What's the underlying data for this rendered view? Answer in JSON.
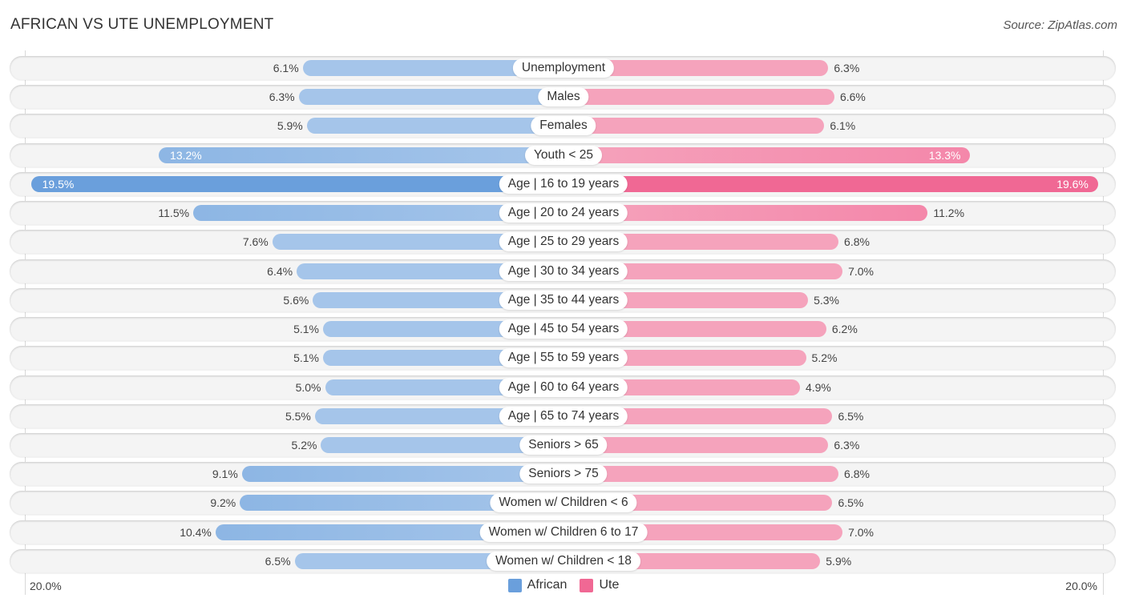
{
  "chart_data": {
    "type": "bar",
    "orientation": "horizontal-diverging",
    "title": "AFRICAN VS UTE UNEMPLOYMENT",
    "source": "Source: ZipAtlas.com",
    "xlabel": "",
    "ylabel": "",
    "xlim": [
      -20,
      20
    ],
    "axis_min_label": "20.0%",
    "axis_max_label": "20.0%",
    "legend_position": "bottom-center",
    "categories": [
      "Unemployment",
      "Males",
      "Females",
      "Youth < 25",
      "Age | 16 to 19 years",
      "Age | 20 to 24 years",
      "Age | 25 to 29 years",
      "Age | 30 to 34 years",
      "Age | 35 to 44 years",
      "Age | 45 to 54 years",
      "Age | 55 to 59 years",
      "Age | 60 to 64 years",
      "Age | 65 to 74 years",
      "Seniors > 65",
      "Seniors > 75",
      "Women w/ Children < 6",
      "Women w/ Children 6 to 17",
      "Women w/ Children < 18"
    ],
    "series": [
      {
        "name": "African",
        "side": "left",
        "color": "#6a9fdc",
        "color_light": "#a5c5ea",
        "values": [
          6.1,
          6.3,
          5.9,
          13.2,
          19.5,
          11.5,
          7.6,
          6.4,
          5.6,
          5.1,
          5.1,
          5.0,
          5.5,
          5.2,
          9.1,
          9.2,
          10.4,
          6.5
        ]
      },
      {
        "name": "Ute",
        "side": "right",
        "color": "#f06894",
        "color_light": "#f5a3bc",
        "values": [
          6.3,
          6.6,
          6.1,
          13.3,
          19.6,
          11.2,
          6.8,
          7.0,
          5.3,
          6.2,
          5.2,
          4.9,
          6.5,
          6.3,
          6.8,
          6.5,
          7.0,
          5.9
        ]
      }
    ]
  }
}
